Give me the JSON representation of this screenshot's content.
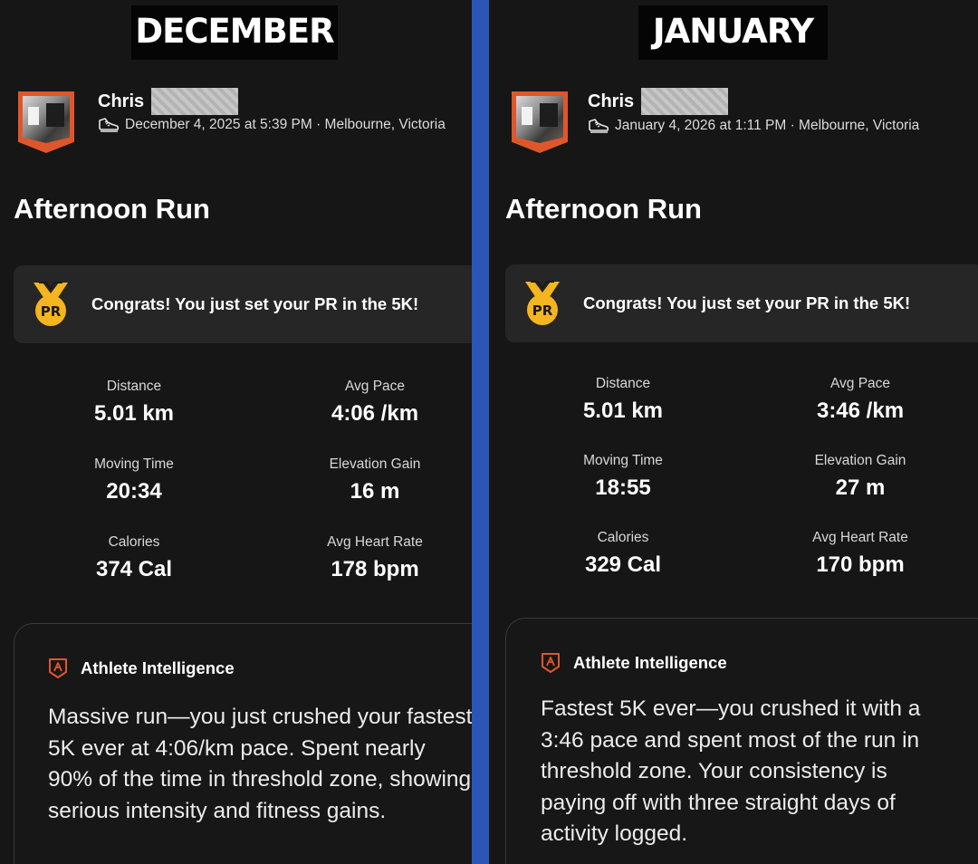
{
  "panels": [
    {
      "month": "DECEMBER",
      "athlete_name": "Chris",
      "meta": "December 4, 2025 at 5:39 PM · Melbourne, Victoria",
      "activity_title": "Afternoon Run",
      "pr_badge": "PR",
      "pr_message": "Congrats! You just set your PR in the 5K!",
      "stats": [
        {
          "label": "Distance",
          "value": "5.01 km"
        },
        {
          "label": "Avg Pace",
          "value": "4:06 /km"
        },
        {
          "label": "Moving Time",
          "value": "20:34"
        },
        {
          "label": "Elevation Gain",
          "value": "16 m"
        },
        {
          "label": "Calories",
          "value": "374 Cal"
        },
        {
          "label": "Avg Heart Rate",
          "value": "178 bpm"
        }
      ],
      "ai_title": "Athlete Intelligence",
      "ai_text": "Massive run—you just crushed your fastest 5K ever at 4:06/km pace. Spent nearly 90% of the time in threshold zone, showing serious intensity and fitness gains."
    },
    {
      "month": "JANUARY",
      "athlete_name": "Chris",
      "meta": "January 4, 2026 at 1:11 PM · Melbourne, Victoria",
      "activity_title": "Afternoon Run",
      "pr_badge": "PR",
      "pr_message": "Congrats! You just set your PR in the 5K!",
      "stats": [
        {
          "label": "Distance",
          "value": "5.01 km"
        },
        {
          "label": "Avg Pace",
          "value": "3:46 /km"
        },
        {
          "label": "Moving Time",
          "value": "18:55"
        },
        {
          "label": "Elevation Gain",
          "value": "27 m"
        },
        {
          "label": "Calories",
          "value": "329 Cal"
        },
        {
          "label": "Avg Heart Rate",
          "value": "170 bpm"
        }
      ],
      "ai_title": "Athlete Intelligence",
      "ai_text": "Fastest 5K ever—you crushed it with a 3:46 pace and spent most of the run in threshold zone. Your consistency is paying off with three straight days of activity logged."
    }
  ],
  "colors": {
    "background": "#161616",
    "divider": "#2b56b8",
    "accent_orange": "#e0562b",
    "pr_gold": "#f5b51f",
    "card": "#262626"
  }
}
